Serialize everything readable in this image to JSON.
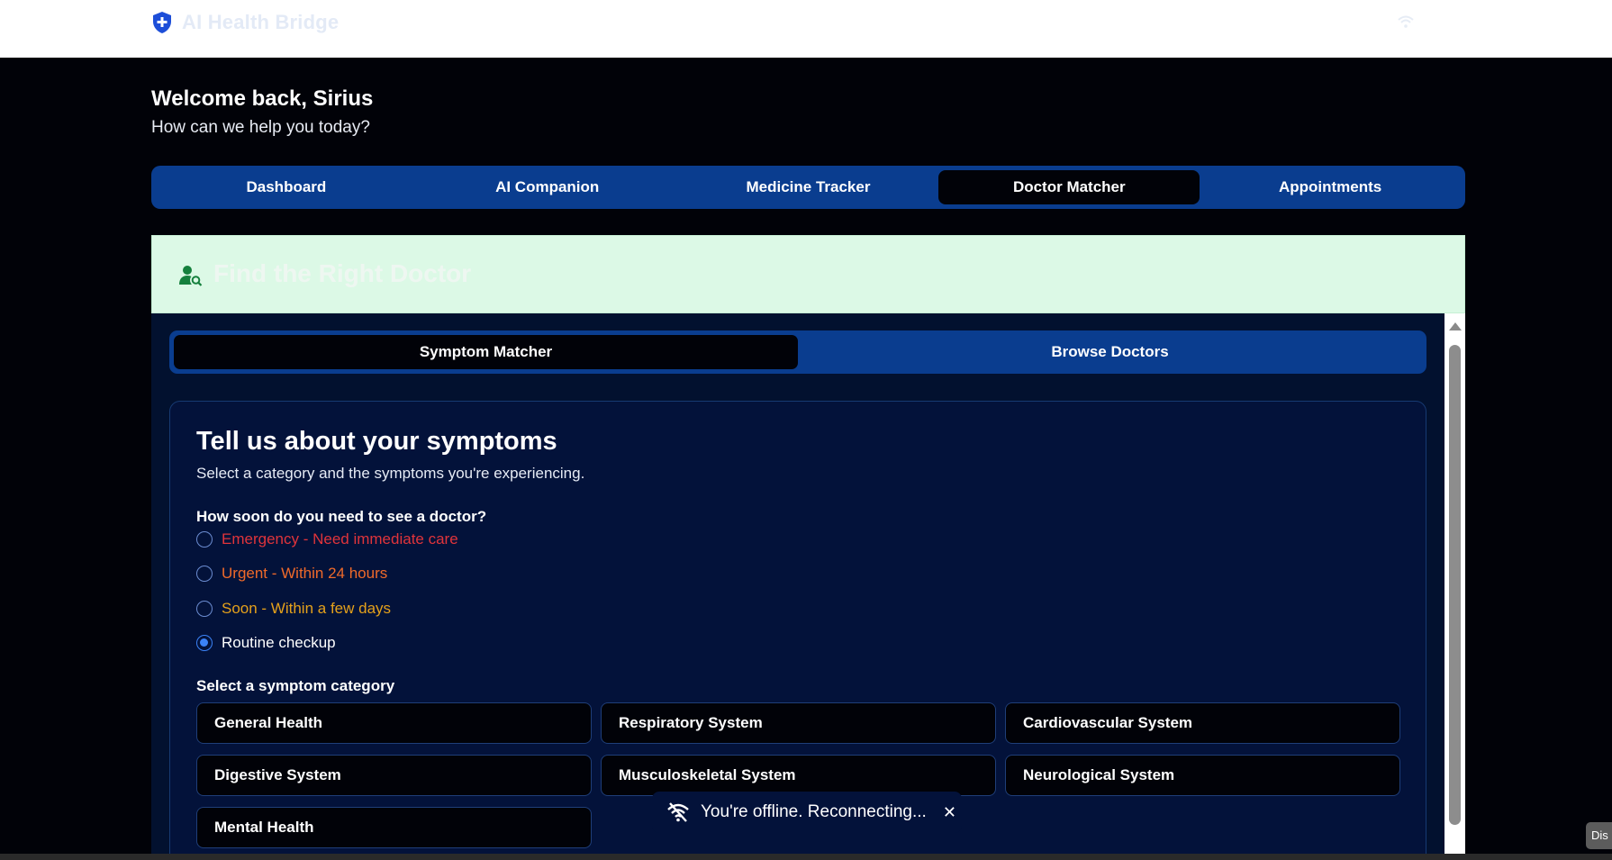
{
  "header": {
    "brand_name": "AI Health Bridge"
  },
  "welcome": {
    "title": "Welcome back, Sirius",
    "subtitle": "How can we help you today?"
  },
  "main_tabs": [
    {
      "label": "Dashboard",
      "active": false
    },
    {
      "label": "AI Companion",
      "active": false
    },
    {
      "label": "Medicine Tracker",
      "active": false
    },
    {
      "label": "Doctor Matcher",
      "active": true
    },
    {
      "label": "Appointments",
      "active": false
    }
  ],
  "card": {
    "title": "Find the Right Doctor"
  },
  "sub_tabs": [
    {
      "label": "Symptom Matcher",
      "active": true
    },
    {
      "label": "Browse Doctors",
      "active": false
    }
  ],
  "symptoms": {
    "title": "Tell us about your symptoms",
    "subtitle": "Select a category and the symptoms you're experiencing.",
    "urgency_question": "How soon do you need to see a doctor?",
    "urgency_options": [
      {
        "label": "Emergency - Need immediate care",
        "color": "#e0343b",
        "checked": false
      },
      {
        "label": "Urgent - Within 24 hours",
        "color": "#f06a2a",
        "checked": false
      },
      {
        "label": "Soon - Within a few days",
        "color": "#e5a11b",
        "checked": false
      },
      {
        "label": "Routine checkup",
        "color": "#ffffff",
        "checked": true
      }
    ],
    "category_label": "Select a symptom category",
    "categories": [
      "General Health",
      "Respiratory System",
      "Cardiovascular System",
      "Digestive System",
      "Musculoskeletal System",
      "Neurological System",
      "Mental Health"
    ]
  },
  "toast": {
    "message": "You're offline. Reconnecting...",
    "close": "✕"
  },
  "corner_tag": "Dis",
  "colors": {
    "accent": "#0a3d8f",
    "background": "#010208",
    "panel": "#03123a",
    "header_green": "#dcf9e6",
    "icon_blue": "#1d4ed8",
    "icon_green": "#15803d"
  }
}
